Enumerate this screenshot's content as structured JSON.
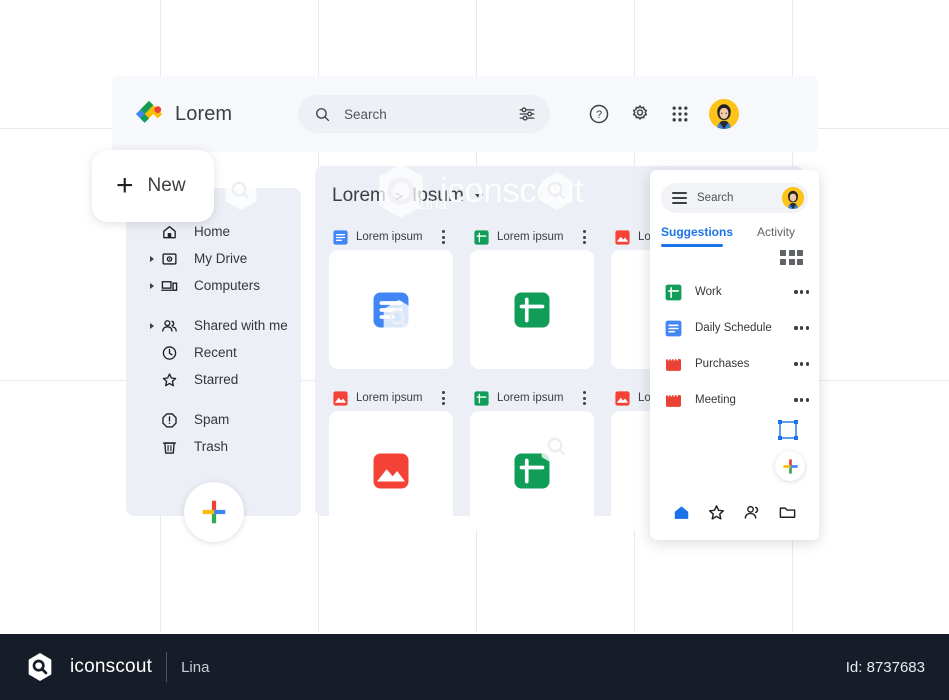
{
  "topbar": {
    "logo_icon": "drive-logo-icon",
    "brand": "Lorem",
    "search": {
      "icon": "search-icon",
      "placeholder": "Search",
      "tune_icon": "tune-icon"
    },
    "help_icon": "help-circle-icon",
    "settings_icon": "gear-icon",
    "apps_icon": "apps-grid-icon",
    "avatar_icon": "user-avatar"
  },
  "sidebar": {
    "new_button": {
      "plus": "+",
      "label": "New"
    },
    "items": [
      {
        "label": "Home",
        "icon": "home-icon",
        "expandable": false
      },
      {
        "label": "My Drive",
        "icon": "drive-icon",
        "expandable": true
      },
      {
        "label": "Computers",
        "icon": "computer-icon",
        "expandable": true
      },
      {
        "label": "Shared with me",
        "icon": "people-icon",
        "expandable": true
      },
      {
        "label": "Recent",
        "icon": "clock-icon",
        "expandable": false
      },
      {
        "label": "Starred",
        "icon": "star-icon",
        "expandable": false
      },
      {
        "label": "Spam",
        "icon": "alert-icon",
        "expandable": false
      },
      {
        "label": "Trash",
        "icon": "trash-icon",
        "expandable": false
      }
    ],
    "fab_icon": "google-plus-icon"
  },
  "main": {
    "breadcrumb": {
      "root": "Lorem",
      "separator": ">",
      "current": "Ipsum",
      "caret": "chevron-down-icon"
    },
    "view_toggle_icon": "list-view-icon",
    "blue_button_icon": "chevron-down-icon",
    "files": [
      {
        "name": "Lorem ipsum",
        "type": "docs",
        "color": "#4285f4"
      },
      {
        "name": "Lorem ipsum",
        "type": "sheets",
        "color": "#0f9d58"
      },
      {
        "name": "Lorem ipsum",
        "type": "image",
        "color": "#f44336"
      },
      {
        "name": "Lorem ipsum",
        "type": "image",
        "color": "#f44336"
      },
      {
        "name": "Lorem ipsum",
        "type": "sheets",
        "color": "#0f9d58"
      },
      {
        "name": "Lorem ipsum",
        "type": "image",
        "color": "#f44336"
      }
    ]
  },
  "panel": {
    "search": {
      "menu_icon": "hamburger-icon",
      "placeholder": "Search",
      "avatar_icon": "user-avatar"
    },
    "tabs": [
      {
        "label": "Suggestions",
        "active": true
      },
      {
        "label": "Activity",
        "active": false
      }
    ],
    "grid_toggle_icon": "grid-view-icon",
    "items": [
      {
        "label": "Work",
        "icon": "sheets-icon",
        "color": "#0f9d58",
        "menu": "more-icon"
      },
      {
        "label": "Daily Schedule",
        "icon": "docs-icon",
        "color": "#4285f4",
        "menu": "more-icon"
      },
      {
        "label": "Purchases",
        "icon": "calendar-icon",
        "color": "#ea4335",
        "menu": "more-icon"
      },
      {
        "label": "Meeting",
        "icon": "calendar-icon",
        "color": "#ea4335",
        "menu": "more-icon"
      }
    ],
    "fab_icon": "google-plus-icon",
    "bottom_nav": [
      {
        "icon": "home-filled-icon",
        "active": true
      },
      {
        "icon": "star-icon",
        "active": false
      },
      {
        "icon": "people-icon",
        "active": false
      },
      {
        "icon": "folder-icon",
        "active": false
      }
    ]
  },
  "overlay": {
    "selection_handle_icon": "transform-handle-icon"
  },
  "watermark": {
    "brand": "iconscout",
    "author": "Lina"
  },
  "footer": {
    "brand": "iconscout",
    "author": "Lina",
    "id": "Id: 8737683"
  },
  "colors": {
    "blue": "#4285f4",
    "green": "#0f9d58",
    "red": "#ea4335",
    "yellow": "#fbbc05",
    "accent": "#1a73e8",
    "footer_bg": "#161c28",
    "panel_bg": "#eceff6"
  }
}
